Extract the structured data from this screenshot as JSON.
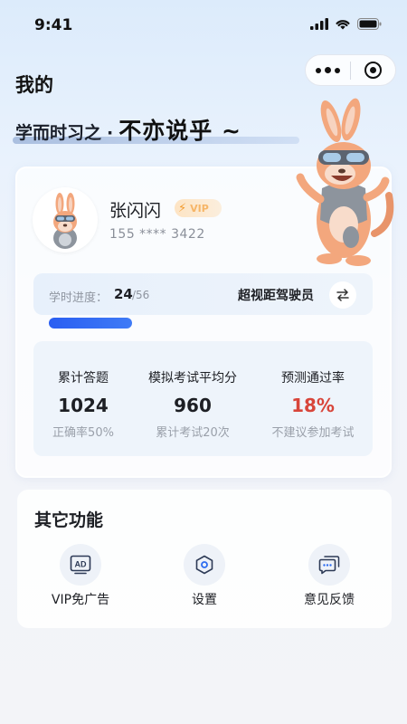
{
  "status_bar": {
    "time": "9:41"
  },
  "nav": {
    "title": "我的"
  },
  "slogan": {
    "part1": "学而时习之",
    "dot": "·",
    "part2": "不亦说乎 ~"
  },
  "profile": {
    "name": "张闪闪",
    "vip": "VIP",
    "phone": "155 **** 3422"
  },
  "progress": {
    "label": "学时进度：",
    "current": "24",
    "total": "/56",
    "fraction": 0.43,
    "license_type": "超视距驾驶员"
  },
  "stats": [
    {
      "label": "累计答题",
      "value": "1024",
      "sub": "正确率50%"
    },
    {
      "label": "模拟考试平均分",
      "value": "960",
      "sub": "累计考试20次"
    },
    {
      "label": "预测通过率",
      "value": "18%",
      "sub": "不建议参加考试"
    }
  ],
  "functions": {
    "title": "其它功能",
    "items": [
      {
        "label": "VIP免广告",
        "icon": "ad-icon",
        "icon_text": "AD"
      },
      {
        "label": "设置",
        "icon": "settings-icon"
      },
      {
        "label": "意见反馈",
        "icon": "feedback-icon"
      }
    ]
  },
  "colors": {
    "accent": "#2a5ef2",
    "danger": "#d8453a",
    "vip": "#f29b2e"
  }
}
